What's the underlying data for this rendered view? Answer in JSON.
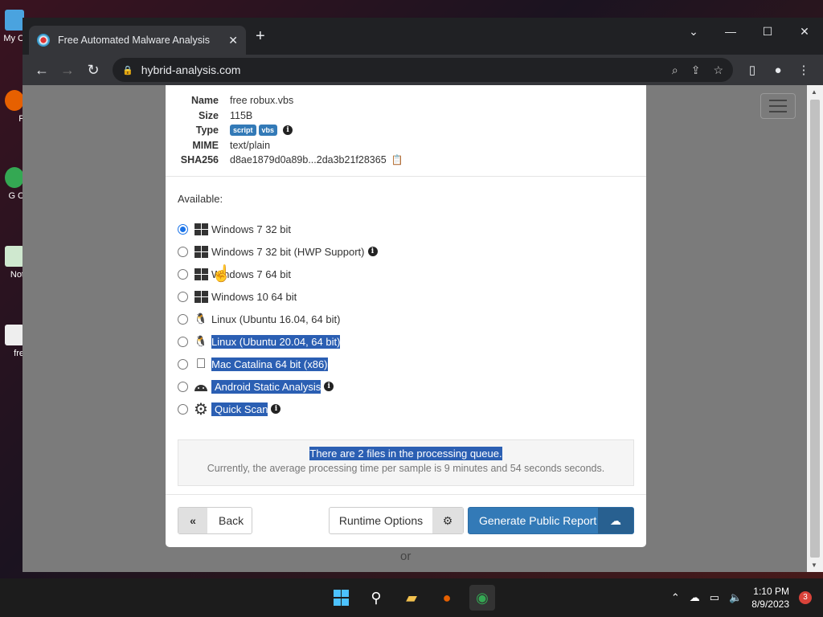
{
  "browser": {
    "tab_title": "Free Automated Malware Analysis",
    "url": "hybrid-analysis.com"
  },
  "file": {
    "labels": {
      "name": "Name",
      "size": "Size",
      "type": "Type",
      "mime": "MIME",
      "sha": "SHA256"
    },
    "name": "free robux.vbs",
    "size": "115B",
    "type_badges": [
      "script",
      "vbs"
    ],
    "mime": "text/plain",
    "sha256": "d8ae1879d0a89b...2da3b21f28365"
  },
  "available_label": "Available:",
  "environments": [
    {
      "label": "Windows 7 32 bit",
      "icon": "windows-icon",
      "selected": true,
      "info": false
    },
    {
      "label": "Windows 7 32 bit (HWP Support)",
      "icon": "windows-icon",
      "selected": false,
      "info": true
    },
    {
      "label": "Windows 7 64 bit",
      "icon": "windows-icon",
      "selected": false,
      "info": false
    },
    {
      "label": "Windows 10 64 bit",
      "icon": "windows-icon",
      "selected": false,
      "info": false
    },
    {
      "label": "Linux (Ubuntu 16.04, 64 bit)",
      "icon": "linux-icon",
      "selected": false,
      "info": false
    },
    {
      "label": "Linux (Ubuntu 20.04, 64 bit)",
      "icon": "linux-icon",
      "selected": false,
      "info": false
    },
    {
      "label": "Mac Catalina 64 bit (x86)",
      "icon": "apple-icon",
      "selected": false,
      "info": false
    },
    {
      "label": "Android Static Analysis",
      "icon": "android-icon",
      "selected": false,
      "info": true
    },
    {
      "label": "Quick Scan",
      "icon": "gear-icon",
      "selected": false,
      "info": true
    }
  ],
  "queue": {
    "line1": "There are 2 files in the processing queue.",
    "line2": "Currently, the average processing time per sample is 9 minutes and 54 seconds seconds."
  },
  "buttons": {
    "back": "Back",
    "runtime": "Runtime Options",
    "generate": "Generate Public Report"
  },
  "page_or": "or",
  "taskbar": {
    "time": "1:10 PM",
    "date": "8/9/2023",
    "notifications": "3"
  },
  "desktop_icons": [
    "My C",
    "F",
    "G C",
    "Not",
    "fre"
  ],
  "colors": {
    "accent": "#337ab7",
    "selection": "#2b5fb3"
  }
}
